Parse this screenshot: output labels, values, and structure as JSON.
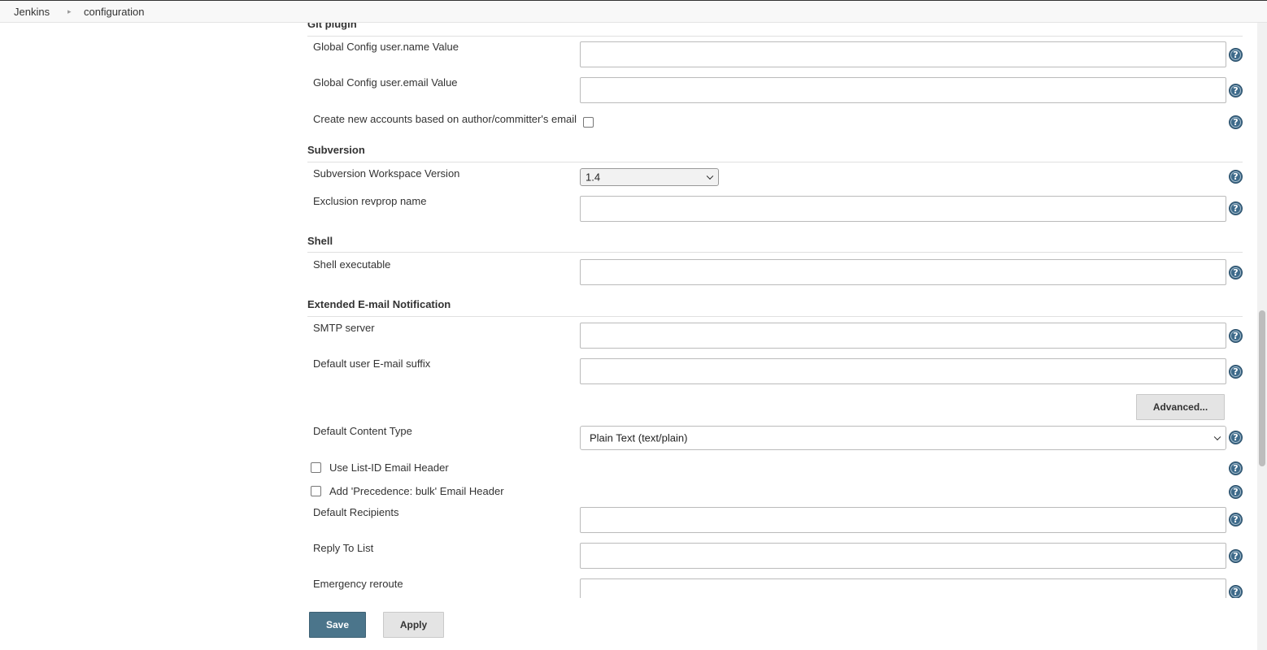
{
  "breadcrumb": {
    "items": [
      "Jenkins",
      "configuration"
    ],
    "separator": "▸"
  },
  "sections": {
    "git": {
      "title": "Git plugin",
      "user_name_label": "Global Config user.name Value",
      "user_name_value": "",
      "user_email_label": "Global Config user.email Value",
      "user_email_value": "",
      "create_accounts_label": "Create new accounts based on author/committer's email",
      "create_accounts_checked": false
    },
    "subversion": {
      "title": "Subversion",
      "workspace_version_label": "Subversion Workspace Version",
      "workspace_version_value": "1.4",
      "exclusion_revprop_label": "Exclusion revprop name",
      "exclusion_revprop_value": ""
    },
    "shell": {
      "title": "Shell",
      "executable_label": "Shell executable",
      "executable_value": ""
    },
    "email": {
      "title": "Extended E-mail Notification",
      "smtp_label": "SMTP server",
      "smtp_value": "",
      "suffix_label": "Default user E-mail suffix",
      "suffix_value": "",
      "advanced_label": "Advanced...",
      "content_type_label": "Default Content Type",
      "content_type_value": "Plain Text (text/plain)",
      "list_id_label": "Use List-ID Email Header",
      "list_id_checked": false,
      "precedence_label": "Add 'Precedence: bulk' Email Header",
      "precedence_checked": false,
      "recipients_label": "Default Recipients",
      "recipients_value": "",
      "reply_to_label": "Reply To List",
      "reply_to_value": "",
      "emergency_label": "Emergency reroute",
      "emergency_value": ""
    }
  },
  "footer": {
    "save_label": "Save",
    "apply_label": "Apply"
  },
  "colors": {
    "primary_button": "#4b758b",
    "help_icon": "#3d6a8a",
    "secondary_button": "#e4e4e4"
  },
  "icons": {
    "help": "question-circle-icon",
    "dropdown": "chevron-down-icon",
    "breadcrumb_separator": "triangle-right-icon"
  }
}
